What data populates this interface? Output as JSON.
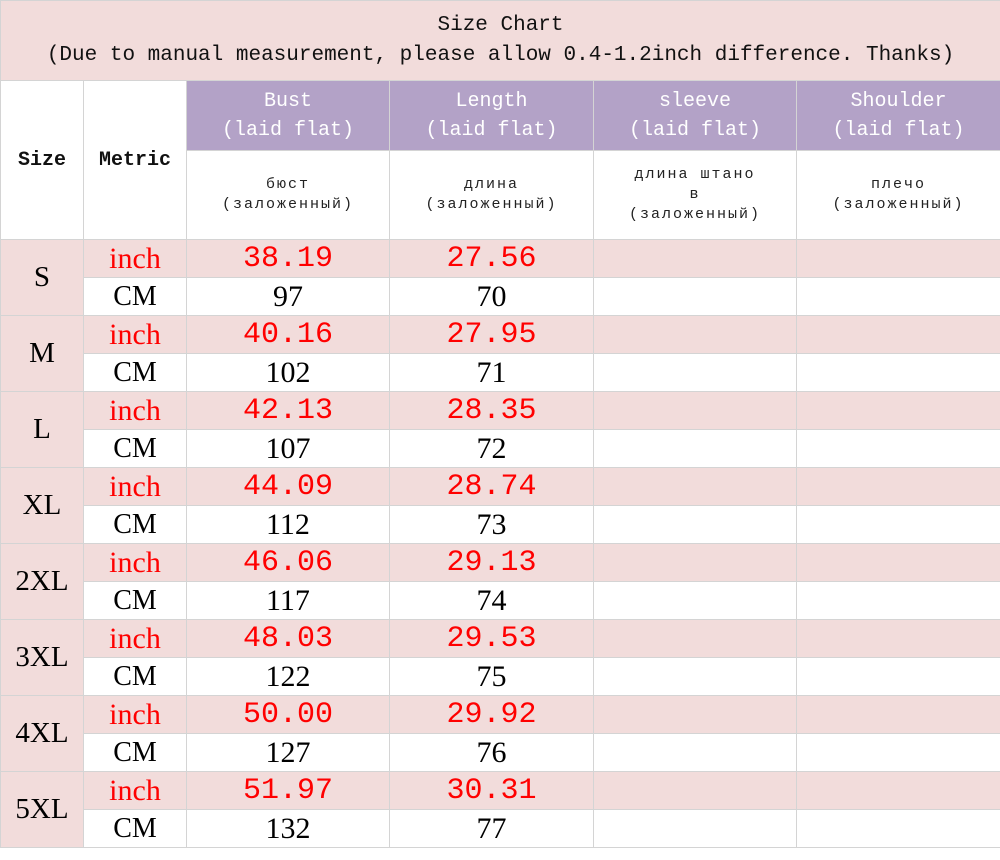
{
  "title": {
    "line1": "Size Chart",
    "line2": "(Due to manual measurement, please allow 0.4-1.2inch difference. Thanks)"
  },
  "headers": {
    "size": "Size",
    "metric": "Metric",
    "columns": [
      {
        "name": "Bust",
        "sub": "(laid flat)",
        "ru_line1": "бюст",
        "ru_line2": "(заложенный)"
      },
      {
        "name": "Length",
        "sub": "(laid flat)",
        "ru_line1": "длина",
        "ru_line2": "(заложенный)"
      },
      {
        "name": "sleeve",
        "sub": "(laid flat)",
        "ru_line1": "длина штано",
        "ru_line1b": "в",
        "ru_line2": "(заложенный)"
      },
      {
        "name": "Shoulder",
        "sub": "(laid flat)",
        "ru_line1": "плечо",
        "ru_line2": "(заложенный)"
      }
    ]
  },
  "units": {
    "inch": "inch",
    "cm": "CM"
  },
  "sizes": [
    {
      "size": "S",
      "inch": [
        "38.19",
        "27.56",
        "",
        ""
      ],
      "cm": [
        "97",
        "70",
        "",
        ""
      ]
    },
    {
      "size": "M",
      "inch": [
        "40.16",
        "27.95",
        "",
        ""
      ],
      "cm": [
        "102",
        "71",
        "",
        ""
      ]
    },
    {
      "size": "L",
      "inch": [
        "42.13",
        "28.35",
        "",
        ""
      ],
      "cm": [
        "107",
        "72",
        "",
        ""
      ]
    },
    {
      "size": "XL",
      "inch": [
        "44.09",
        "28.74",
        "",
        ""
      ],
      "cm": [
        "112",
        "73",
        "",
        ""
      ]
    },
    {
      "size": "2XL",
      "inch": [
        "46.06",
        "29.13",
        "",
        ""
      ],
      "cm": [
        "117",
        "74",
        "",
        ""
      ]
    },
    {
      "size": "3XL",
      "inch": [
        "48.03",
        "29.53",
        "",
        ""
      ],
      "cm": [
        "122",
        "75",
        "",
        ""
      ]
    },
    {
      "size": "4XL",
      "inch": [
        "50.00",
        "29.92",
        "",
        ""
      ],
      "cm": [
        "127",
        "76",
        "",
        ""
      ]
    },
    {
      "size": "5XL",
      "inch": [
        "51.97",
        "30.31",
        "",
        ""
      ],
      "cm": [
        "132",
        "77",
        "",
        ""
      ]
    }
  ],
  "colors": {
    "title_bg": "#f2dcdb",
    "header_purple": "#b3a2c7",
    "inch_row_bg": "#f2dcdb",
    "inch_text": "#ff0000"
  }
}
